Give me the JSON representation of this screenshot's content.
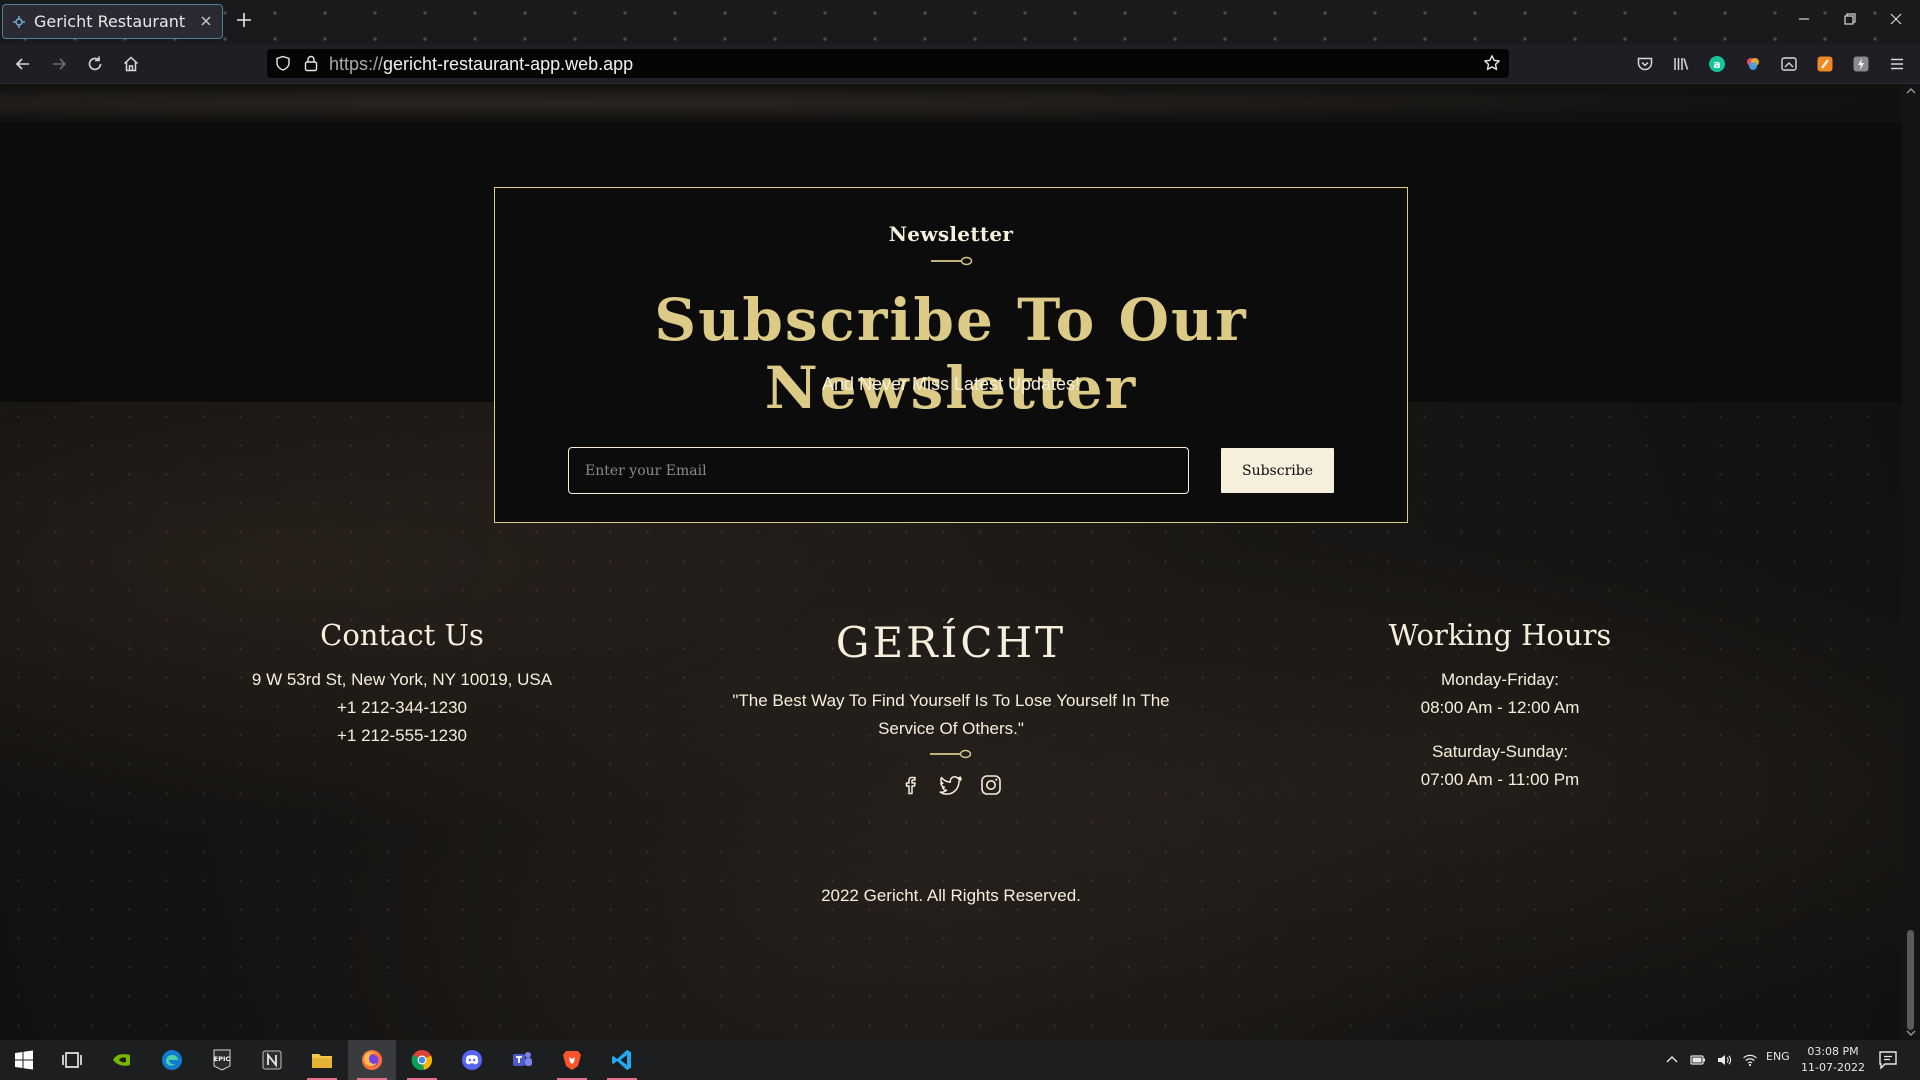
{
  "browser": {
    "tab_title": "Gericht Restaurant",
    "url_prefix": "https://",
    "url_domain": "gericht-restaurant-app.web.app"
  },
  "newsletter": {
    "subheading": "Newsletter",
    "title": "Subscribe To Our Newsletter",
    "description": "And Never Miss Latest Updates!",
    "email_placeholder": "Enter your Email",
    "subscribe_label": "Subscribe"
  },
  "footer": {
    "contact": {
      "heading": "Contact Us",
      "address": "9 W 53rd St, New York, NY 10019, USA",
      "phone_1": "+1 212-344-1230",
      "phone_2": "+1 212-555-1230"
    },
    "brand": {
      "logo": "GERÍCHT",
      "quote": "\"The Best Way To Find Yourself Is To Lose Yourself In The Service Of Others.\"",
      "socials": [
        "facebook-icon",
        "twitter-icon",
        "instagram-icon"
      ]
    },
    "hours": {
      "heading": "Working Hours",
      "weekday_label": "Monday-Friday:",
      "weekday_time": "08:00 Am - 12:00 Am",
      "weekend_label": "Saturday-Sunday:",
      "weekend_time": "07:00 Am - 11:00 Pm"
    },
    "copyright": "2022 Gericht. All Rights Reserved."
  },
  "taskbar": {
    "language": "ENG",
    "time": "03:08 PM",
    "date": "11-07-2022",
    "apps": [
      "windows-start-icon",
      "task-view-icon",
      "nvidia-icon",
      "edge-icon",
      "epic-games-icon",
      "notion-icon",
      "file-explorer-icon",
      "firefox-icon",
      "chrome-icon",
      "discord-icon",
      "teams-icon",
      "brave-icon",
      "vscode-icon"
    ]
  },
  "colors": {
    "gold": "#dcca87",
    "cream": "#f5efdb",
    "background": "#0c0c0c"
  }
}
